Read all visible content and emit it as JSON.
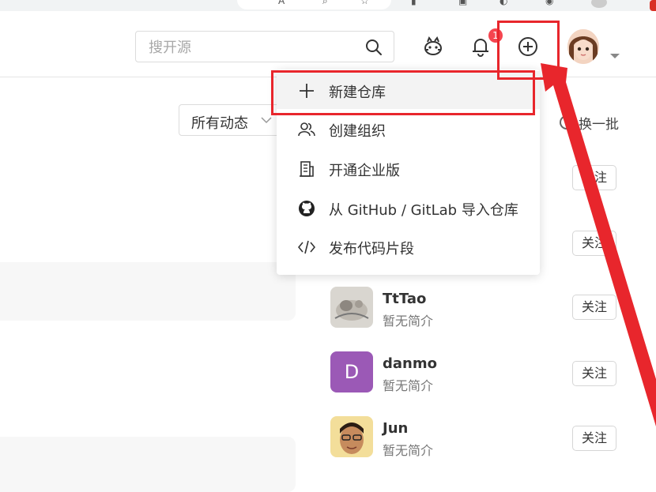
{
  "header": {
    "search_placeholder": "搜开源",
    "notification_count": "1"
  },
  "main": {
    "filter_label": "所有动态",
    "refresh_label": "换一批"
  },
  "dropdown": {
    "items": [
      {
        "label": "新建仓库",
        "icon": "plus-icon"
      },
      {
        "label": "创建组织",
        "icon": "users-icon"
      },
      {
        "label": "开通企业版",
        "icon": "building-icon"
      },
      {
        "label": "从 GitHub / GitLab 导入仓库",
        "icon": "github-icon"
      },
      {
        "label": "发布代码片段",
        "icon": "code-icon"
      }
    ]
  },
  "recommended_users": [
    {
      "name": "",
      "desc": "",
      "follow": "关注"
    },
    {
      "name": "",
      "desc": "",
      "follow": "关注"
    },
    {
      "name": "TtTao",
      "desc": "暂无简介",
      "follow": "关注"
    },
    {
      "name": "danmo",
      "desc": "暂无简介",
      "follow": "关注",
      "avatar_letter": "D",
      "avatar_color": "#9b59b6"
    },
    {
      "name": "Jun",
      "desc": "暂无简介",
      "follow": "关注"
    }
  ],
  "colors": {
    "annotation_red": "#e8262c",
    "badge_red": "#f5454f",
    "danmo_avatar": "#9b59b6"
  }
}
